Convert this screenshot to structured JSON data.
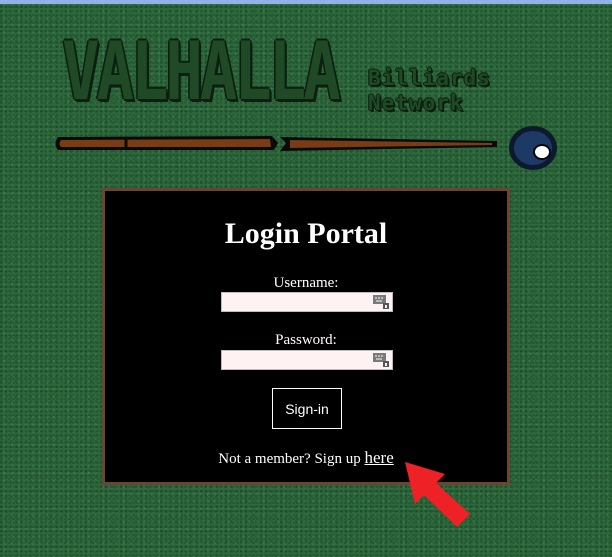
{
  "logo": {
    "title": "VALHALLA",
    "subtitle_line1": "Billiards",
    "subtitle_line2": "Network"
  },
  "login": {
    "title": "Login Portal",
    "username_label": "Username:",
    "username_value": "",
    "password_label": "Password:",
    "password_value": "",
    "signin_label": "Sign-in",
    "signup_text": "Not a member? Sign up",
    "signup_link": "here"
  },
  "colors": {
    "background": "#2c6a3c",
    "panel": "#000000",
    "panel_border": "#6b4530",
    "field_bg": "#fff2f2",
    "arrow": "#ee2127"
  },
  "icons": [
    "cue-stick-icon",
    "billiard-ball-icon",
    "keyboard-icon",
    "red-arrow-icon"
  ]
}
